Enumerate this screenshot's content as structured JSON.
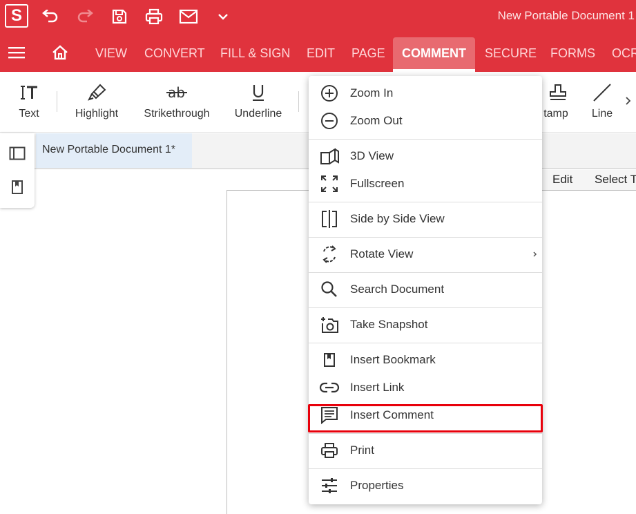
{
  "app": {
    "logo_letter": "S",
    "document_title": "New Portable Document 1"
  },
  "menu_tabs": [
    {
      "label": "VIEW"
    },
    {
      "label": "CONVERT"
    },
    {
      "label": "FILL & SIGN"
    },
    {
      "label": "EDIT"
    },
    {
      "label": "PAGE"
    },
    {
      "label": "COMMENT",
      "active": true
    },
    {
      "label": "SECURE"
    },
    {
      "label": "FORMS"
    },
    {
      "label": "OCR"
    }
  ],
  "ribbon_tools": [
    {
      "label": "Text",
      "icon": "text-tool-icon"
    },
    {
      "label": "Highlight",
      "icon": "highlighter-icon"
    },
    {
      "label": "Strikethrough",
      "icon": "strikethrough-icon"
    },
    {
      "label": "Underline",
      "icon": "underline-icon"
    },
    {
      "label": "tamp",
      "icon": "stamp-icon"
    },
    {
      "label": "Line",
      "icon": "line-icon"
    }
  ],
  "document_tab": {
    "label": "New Portable Document 1*"
  },
  "secondary_toolbar": {
    "edit_label": "Edit",
    "select_label": "Select T"
  },
  "dropdown_menu": {
    "items": [
      {
        "label": "Zoom In",
        "icon": "zoom-in-icon"
      },
      {
        "label": "Zoom Out",
        "icon": "zoom-out-icon"
      },
      {
        "label": "3D View",
        "icon": "3d-view-icon"
      },
      {
        "label": "Fullscreen",
        "icon": "fullscreen-icon"
      },
      {
        "label": "Side by Side View",
        "icon": "side-by-side-icon"
      },
      {
        "label": "Rotate View",
        "icon": "rotate-icon",
        "has_submenu": true
      },
      {
        "label": "Search Document",
        "icon": "search-icon"
      },
      {
        "label": "Take Snapshot",
        "icon": "camera-icon"
      },
      {
        "label": "Insert Bookmark",
        "icon": "bookmark-icon"
      },
      {
        "label": "Insert Link",
        "icon": "link-icon"
      },
      {
        "label": "Insert Comment",
        "icon": "comment-icon",
        "highlighted": true
      },
      {
        "label": "Print",
        "icon": "print-icon"
      },
      {
        "label": "Properties",
        "icon": "properties-icon"
      }
    ]
  },
  "colors": {
    "brand_red": "#e0333d",
    "active_tab": "#e86a70",
    "highlight_outline": "#e8000b"
  }
}
